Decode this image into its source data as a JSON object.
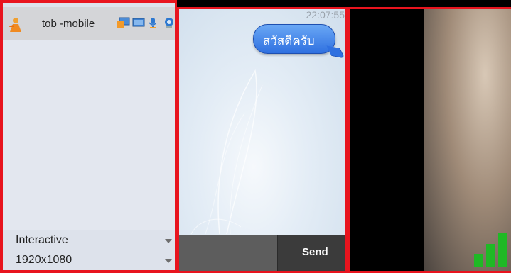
{
  "contact": {
    "name": "tob -mobile"
  },
  "toolbar": {
    "icons": [
      "person-icon",
      "screen-share-icon",
      "monitor-icon",
      "microphone-icon",
      "webcam-icon"
    ]
  },
  "settings": {
    "mode": "Interactive",
    "resolution": "1920x1080"
  },
  "chat": {
    "timestamp": "22:07:55",
    "messages": [
      {
        "text": "สวัสดีครับ"
      }
    ],
    "input_value": "",
    "send_label": "Send"
  },
  "video": {
    "signal_bars": 3
  },
  "colors": {
    "border": "#e8141e",
    "bubble": "#3f83ea",
    "signal": "#1fb925"
  }
}
